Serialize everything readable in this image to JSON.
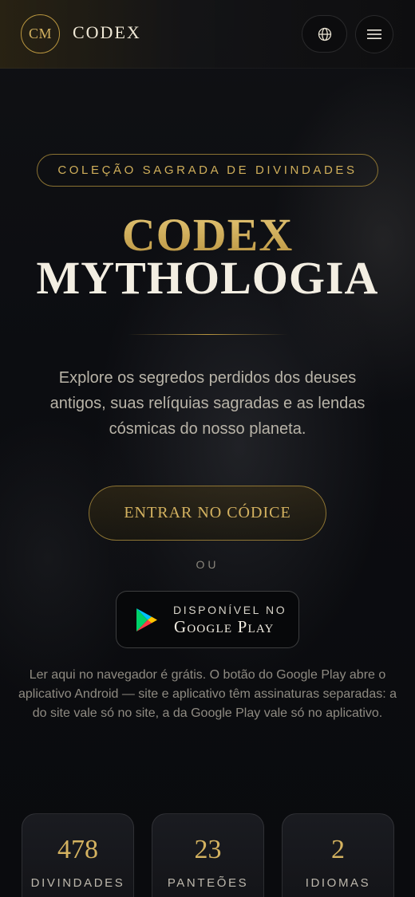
{
  "header": {
    "logo_initials": "CM",
    "brand": "CODEX",
    "icons": [
      "globe-icon",
      "hamburger-menu-icon"
    ]
  },
  "hero": {
    "badge": "COLEÇÃO SAGRADA DE DIVINDADES",
    "title_line1": "CODEX",
    "title_line2": "MYTHOLOGIA",
    "lead": "Explore os segredos perdidos dos deuses antigos, suas relíquias sagradas e as lendas cósmicas do nosso planeta.",
    "cta_label": "ENTRAR NO CÓDICE",
    "or_label": "OU",
    "google_play": {
      "small": "DISPONÍVEL NO",
      "big": "Google Play"
    },
    "note": "Ler aqui no navegador é grátis. O botão do Google Play abre o aplicativo Android — site e aplicativo têm assinaturas separadas: a do site vale só no site, a da Google Play vale só no aplicativo."
  },
  "stats": [
    {
      "value": "478",
      "label": "DIVINDADES"
    },
    {
      "value": "23",
      "label": "PANTEÕES"
    },
    {
      "value": "2",
      "label": "IDIOMAS"
    }
  ],
  "colors": {
    "gold": "#d4b260",
    "background": "#0b0c10",
    "text_muted": "#b9b4a8"
  }
}
